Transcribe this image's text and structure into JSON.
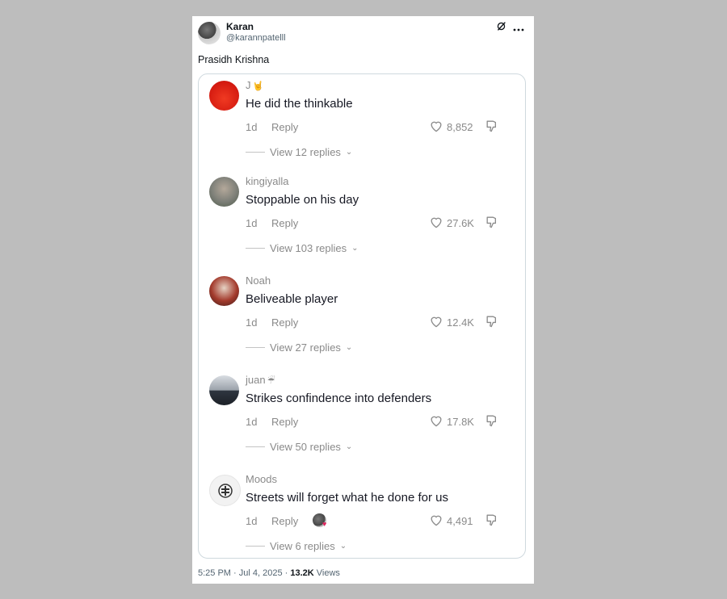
{
  "tweet": {
    "author_name": "Karan",
    "author_handle": "@karannpatelll",
    "text": "Prasidh Krishna",
    "time": "5:25 PM · Jul 4, 2025",
    "separator": " · ",
    "views_count": "13.2K",
    "views_label": " Views"
  },
  "comments": [
    {
      "user": "J",
      "user_emoji": "🤘",
      "text": "He did the thinkable",
      "date": "1d",
      "reply": "Reply",
      "likes": "8,852",
      "view_replies": "View 12 replies",
      "avatar_color": "#e0261b"
    },
    {
      "user": "kingiyalla",
      "user_emoji": "",
      "text": "Stoppable on his day",
      "date": "1d",
      "reply": "Reply",
      "likes": "27.6K",
      "view_replies": "View 103 replies",
      "avatar_color": "#8a8f84"
    },
    {
      "user": "Noah",
      "user_emoji": "",
      "text": "Beliveable player",
      "date": "1d",
      "reply": "Reply",
      "likes": "12.4K",
      "view_replies": "View 27 replies",
      "avatar_color": "#a33a2c"
    },
    {
      "user": "juan",
      "user_emoji": "☔",
      "text": "Strikes confindence into defenders",
      "date": "1d",
      "reply": "Reply",
      "likes": "17.8K",
      "view_replies": "View 50 replies",
      "avatar_color": "#6d7480"
    },
    {
      "user": "Moods",
      "user_emoji": "",
      "text": "Streets will forget what he done for us",
      "date": "1d",
      "reply": "Reply",
      "likes": "4,491",
      "view_replies": "View 6 replies",
      "avatar_color": "#f2f2f2"
    }
  ]
}
